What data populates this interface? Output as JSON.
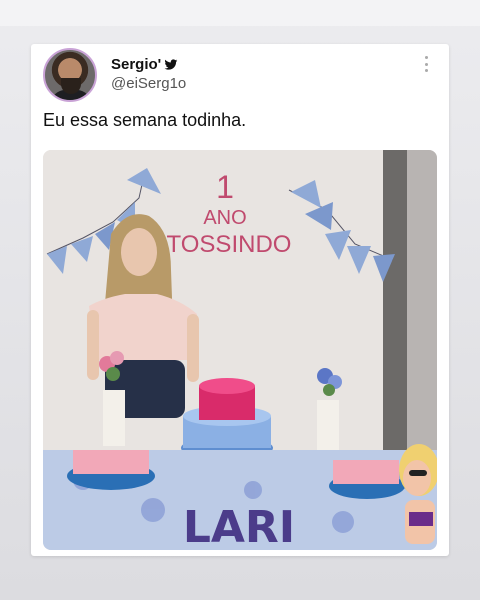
{
  "tweet": {
    "display_name": "Sergio'",
    "handle": "@eiSerg1o",
    "text": "Eu essa semana todinha.",
    "icons": {
      "verified": "bird-icon",
      "menu": "more-options-icon"
    }
  },
  "photo": {
    "banner_number": "1",
    "banner_line1": "ANO",
    "banner_line2": "TOSSINDO",
    "table_letters": "LARI"
  },
  "colors": {
    "card_bg": "#ffffff",
    "accent_blue": "#1d9bf0",
    "banner_text": "#c04a6e"
  }
}
